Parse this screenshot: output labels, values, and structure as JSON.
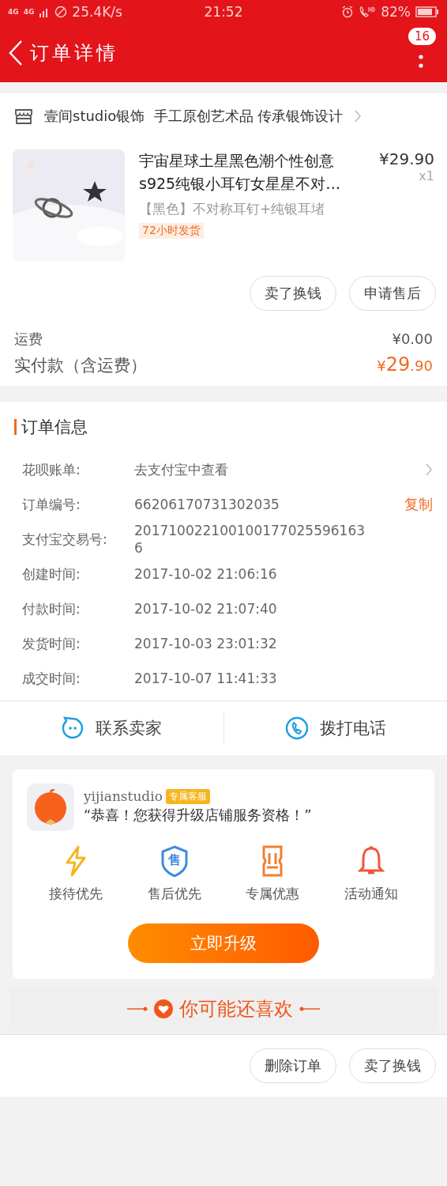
{
  "status_bar": {
    "networks": [
      "4G",
      "4G"
    ],
    "speed": "25.4K/s",
    "time": "21:52",
    "battery": "82%"
  },
  "header": {
    "title": "订单详情",
    "badge": "16"
  },
  "shop": {
    "name": "壹间studio银饰  手工原创艺术品 传承银饰设计"
  },
  "product": {
    "title": "宇宙星球土星黑色潮个性创意s925纯银小耳钉女星星不对…",
    "price": "¥29.90",
    "quantity": "x1",
    "sku": "【黑色】不对称耳钉+纯银耳堵",
    "tag": "72小时发货",
    "buttons": [
      "卖了换钱",
      "申请售后"
    ]
  },
  "totals": [
    {
      "label": "运费",
      "value": "¥0.00",
      "kind": "plain"
    },
    {
      "label": "实付款（含运费）",
      "value": "¥**29**.90",
      "kind": "total"
    }
  ],
  "order_info": {
    "title": "订单信息",
    "rows": [
      {
        "label": "花呗账单:",
        "value": "去支付宝中查看",
        "kind": "arrow"
      },
      {
        "label": "订单编号:",
        "value": "66206170731302035",
        "kind": "copy",
        "action": "复制"
      },
      {
        "label": "支付宝交易号:",
        "value": "2017100221001001770255961636",
        "kind": "plain"
      },
      {
        "label": "创建时间:",
        "value": "2017-10-02 21:06:16",
        "kind": "plain"
      },
      {
        "label": "付款时间:",
        "value": "2017-10-02 21:07:40",
        "kind": "plain"
      },
      {
        "label": "发货时间:",
        "value": "2017-10-03 23:01:32",
        "kind": "plain"
      },
      {
        "label": "成交时间:",
        "value": "2017-10-07 11:41:33",
        "kind": "plain"
      }
    ]
  },
  "contact": [
    {
      "label": "联系卖家",
      "kind": "chat"
    },
    {
      "label": "拨打电话",
      "kind": "phone"
    }
  ],
  "upgrade": {
    "name": "yijianstudio",
    "tag": "专属客服",
    "message": "“恭喜！您获得升级店铺服务资格！”",
    "benefits": [
      {
        "label": "接待优先",
        "kind": "lightning"
      },
      {
        "label": "售后优先",
        "kind": "shield",
        "icon_text": "售"
      },
      {
        "label": "专属优惠",
        "kind": "ticket"
      },
      {
        "label": "活动通知",
        "kind": "bell"
      }
    ],
    "button": "立即升级"
  },
  "recommend": {
    "title": "你可能还喜欢"
  },
  "bottom_buttons": [
    "删除订单",
    "卖了换钱"
  ]
}
